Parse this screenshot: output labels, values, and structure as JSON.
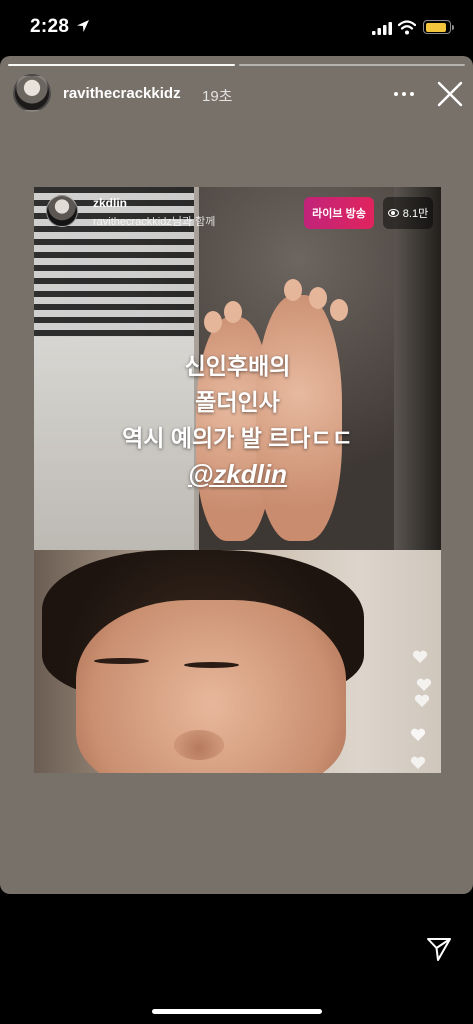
{
  "status_bar": {
    "time": "2:28",
    "icons": [
      "location-arrow-icon",
      "cellular-signal-icon",
      "wifi-icon",
      "battery-icon"
    ],
    "battery_color": "#f2c53d"
  },
  "story": {
    "username": "ravithecrackkidz",
    "posted_ago": "19초",
    "progress_segments": 2,
    "current_segment": 1,
    "background_color": "#78716a"
  },
  "embedded_live": {
    "host_name": "zkdlin",
    "with_text": "ravithecrackkidz님과 함께",
    "live_badge": "라이브 방송",
    "viewer_count": "8.1만",
    "live_badge_color": "#e0245e",
    "caption_lines": [
      "신인후배의",
      "폴더인사",
      "역시 예의가 발 르다ㄷㄷ"
    ],
    "mention": "@zkdlin"
  },
  "bottom_bar": {
    "send_icon": "paper-plane-icon"
  }
}
